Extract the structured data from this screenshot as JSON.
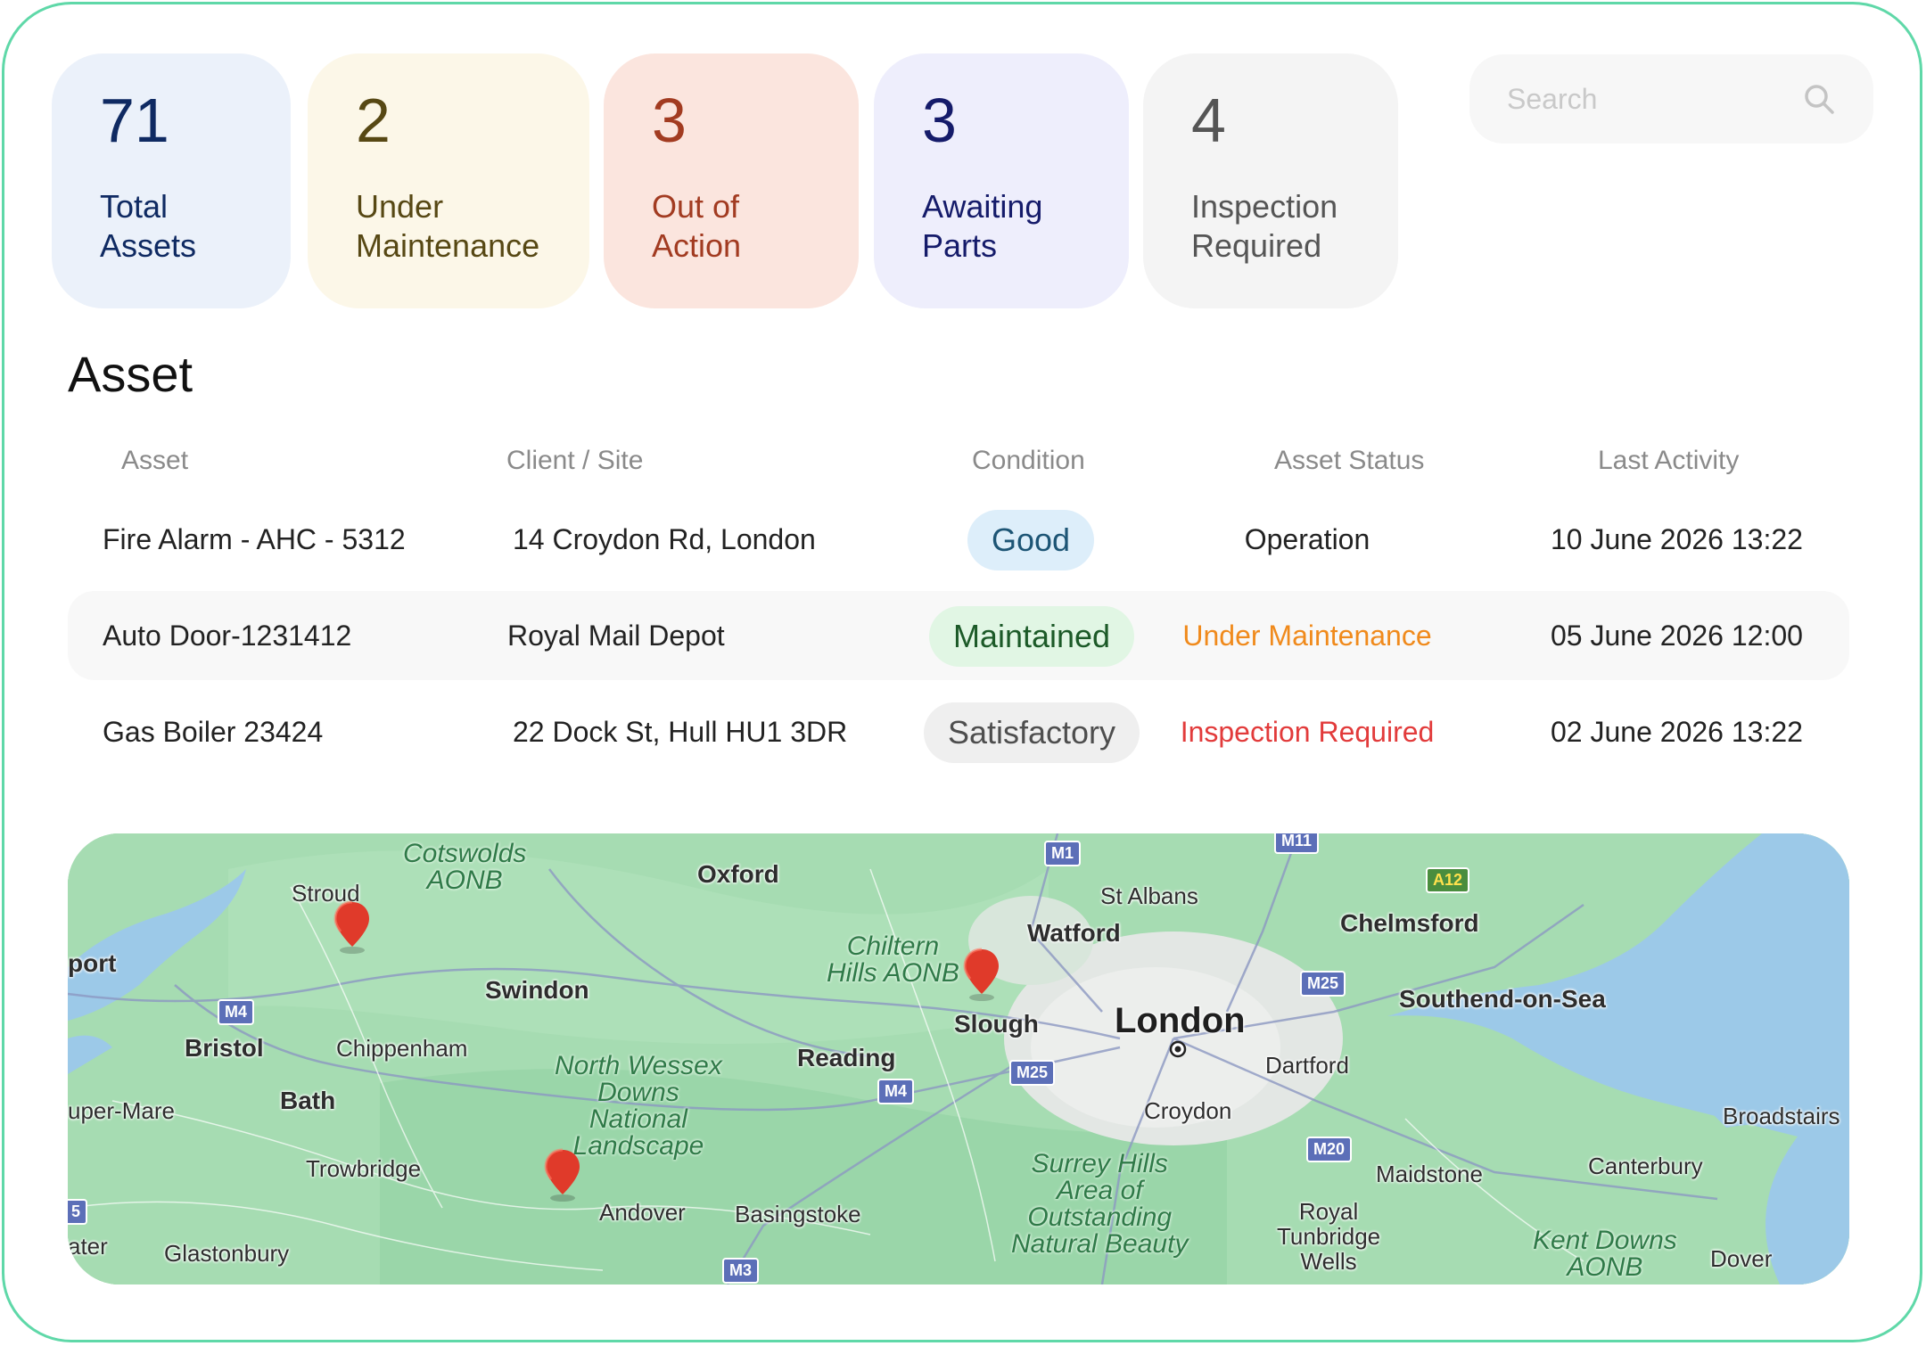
{
  "stats": [
    {
      "value": "71",
      "label": "Total\nAssets"
    },
    {
      "value": "2",
      "label": "Under\nMaintenance"
    },
    {
      "value": "3",
      "label": "Out of\nAction"
    },
    {
      "value": "3",
      "label": "Awaiting\nParts"
    },
    {
      "value": "4",
      "label": "Inspection\nRequired"
    }
  ],
  "search": {
    "placeholder": "Search",
    "icon": "search-icon"
  },
  "section_title": "Asset",
  "table": {
    "columns": [
      "Asset",
      "Client / Site",
      "Condition",
      "Asset Status",
      "Last Activity"
    ],
    "rows": [
      {
        "asset": "Fire Alarm - AHC - 5312",
        "site": "14 Croydon Rd, London",
        "condition": "Good",
        "status": "Operation",
        "last": "10 June 2026 13:22"
      },
      {
        "asset": "Auto Door-1231412",
        "site": "Royal Mail Depot",
        "condition": "Maintained",
        "status": "Under Maintenance",
        "last": "05 June 2026 12:00"
      },
      {
        "asset": "Gas Boiler 23424",
        "site": "22 Dock St, Hull HU1 3DR",
        "condition": "Satisfactory",
        "status": "Inspection Required",
        "last": "02 June 2026 13:22"
      }
    ]
  },
  "colors": {
    "status_operation": "#222222",
    "status_under_maintenance": "#f08a1c",
    "status_inspection_required": "#e23b3b",
    "frame_border": "#5fd8a8",
    "pin": "#e03a2a"
  },
  "map": {
    "places": [
      "Stroud",
      "Cotswolds\nAONB",
      "Oxford",
      "St Albans",
      "Watford",
      "Chelmsford",
      "port",
      "Swindon",
      "Chiltern\nHills AONB",
      "Slough",
      "London",
      "Southend-on-Sea",
      "Bristol",
      "Chippenham",
      "Reading",
      "Dartford",
      "uper-Mare",
      "Bath",
      "North Wessex\nDowns\nNational\nLandscape",
      "Croydon",
      "Broadstairs",
      "Trowbridge",
      "Surrey Hills\nArea of\nOutstanding\nNatural Beauty",
      "Maidstone",
      "Canterbury",
      "Andover",
      "Basingstoke",
      "Royal\nTunbridge\nWells",
      "Kent Downs\nAONB",
      "Dover",
      "ater",
      "Glastonbury"
    ],
    "roads": [
      "M1",
      "M11",
      "A12",
      "M4",
      "M25",
      "M25",
      "M4",
      "M20",
      "M3",
      "5"
    ]
  }
}
